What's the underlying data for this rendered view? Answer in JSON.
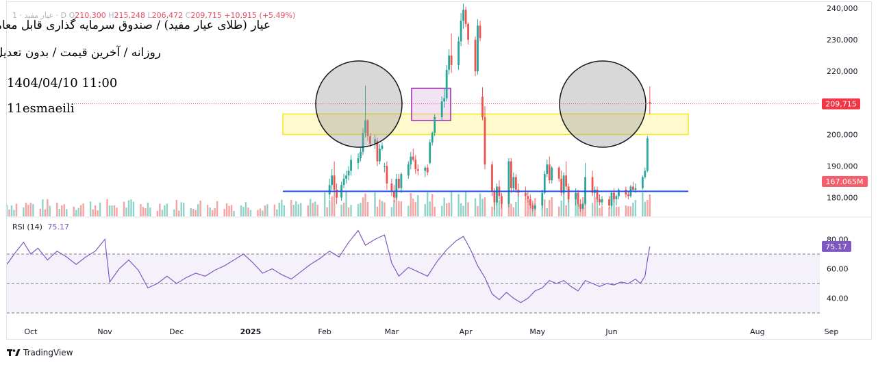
{
  "header": {
    "ohlc_symbol": "عیار مفید · 1 · D",
    "open_label": "O",
    "open_value": "210,300",
    "high_label": "H",
    "high_value": "215,248",
    "low_label": "L",
    "low_value": "206,472",
    "close_label": "C",
    "close_value": "209,715",
    "change_value": "+10,915 (+5.49%)",
    "title": "عیار (طلای عیار مفید) / صندوق سرمایه گذاری قابل معامله",
    "subtitle": "روزانه / آخرین قیمت / بدون تعدیل",
    "datetime": "1404/04/10 11:00",
    "author": "11esmaeili"
  },
  "price_axis": {
    "ticks": [
      "240,000",
      "230,000",
      "220,000",
      "210,000",
      "200,000",
      "190,000",
      "180,000"
    ],
    "last_price_label": "209,715",
    "volume_label": "167.065M"
  },
  "rsi": {
    "legend_label": "RSI (14)",
    "legend_value": "75.17",
    "ticks": [
      "80.00",
      "60.00",
      "40.00"
    ],
    "value_label": "75.17"
  },
  "time_axis": {
    "labels": [
      "Oct",
      "Nov",
      "Dec",
      "2025",
      "Feb",
      "Mar",
      "Apr",
      "May",
      "Jun",
      "Aug",
      "Sep"
    ]
  },
  "branding": {
    "name": "TradingView"
  },
  "colors": {
    "up": "#26a69a",
    "down": "#ef5350",
    "rsi_line": "#7e57c2",
    "rsi_band": "#ede7f6",
    "support_line": "#1e53e5",
    "zone_fill": "#fff9c4",
    "zone_stroke": "#f5e71c",
    "box_stroke": "#9c27b0",
    "last_price": "#f23645"
  },
  "chart_data": {
    "type": "candlestick",
    "xlabel": "",
    "ylabel": "",
    "ylim": [
      175000,
      242000
    ],
    "rsi_ylim": [
      30,
      85
    ],
    "rsi_levels": [
      70,
      50,
      30
    ],
    "support_level": 182000,
    "zone_range": [
      200000,
      206500
    ],
    "last_price": 209715,
    "candles": [
      {
        "date": "2025-02-03",
        "o": 181000,
        "h": 186000,
        "l": 179500,
        "c": 184000
      },
      {
        "date": "2025-02-04",
        "o": 184000,
        "h": 189000,
        "l": 182500,
        "c": 187000
      },
      {
        "date": "2025-02-05",
        "o": 187000,
        "h": 191500,
        "l": 180500,
        "c": 182500
      },
      {
        "date": "2025-02-06",
        "o": 182500,
        "h": 184500,
        "l": 178000,
        "c": 180000
      },
      {
        "date": "2025-02-08",
        "o": 180000,
        "h": 185000,
        "l": 179000,
        "c": 184000
      },
      {
        "date": "2025-02-09",
        "o": 184000,
        "h": 187500,
        "l": 183000,
        "c": 186000
      },
      {
        "date": "2025-02-10",
        "o": 186000,
        "h": 188500,
        "l": 184500,
        "c": 187000
      },
      {
        "date": "2025-02-11",
        "o": 187000,
        "h": 190000,
        "l": 185500,
        "c": 188500
      },
      {
        "date": "2025-02-12",
        "o": 188500,
        "h": 193500,
        "l": 187000,
        "c": 192000
      },
      {
        "date": "2025-02-15",
        "o": 191000,
        "h": 194000,
        "l": 189000,
        "c": 192500
      },
      {
        "date": "2025-02-16",
        "o": 192500,
        "h": 196000,
        "l": 191500,
        "c": 194500
      },
      {
        "date": "2025-02-17",
        "o": 194500,
        "h": 202000,
        "l": 193500,
        "c": 200500
      },
      {
        "date": "2025-02-18",
        "o": 200500,
        "h": 215500,
        "l": 199000,
        "c": 204500
      },
      {
        "date": "2025-02-19",
        "o": 204500,
        "h": 204800,
        "l": 198000,
        "c": 199500
      },
      {
        "date": "2025-02-20",
        "o": 199500,
        "h": 200500,
        "l": 196000,
        "c": 197000
      },
      {
        "date": "2025-02-22",
        "o": 197000,
        "h": 200000,
        "l": 195500,
        "c": 198500
      },
      {
        "date": "2025-02-23",
        "o": 198000,
        "h": 199000,
        "l": 190000,
        "c": 191500
      },
      {
        "date": "2025-02-24",
        "o": 191500,
        "h": 197000,
        "l": 190500,
        "c": 195500
      },
      {
        "date": "2025-02-25",
        "o": 195500,
        "h": 197500,
        "l": 195000,
        "c": 196500
      },
      {
        "date": "2025-02-26",
        "o": 190000,
        "h": 191000,
        "l": 188000,
        "c": 190000
      },
      {
        "date": "2025-02-27",
        "o": 190000,
        "h": 191500,
        "l": 182500,
        "c": 184500
      },
      {
        "date": "2025-03-01",
        "o": 184500,
        "h": 186000,
        "l": 180500,
        "c": 182000
      },
      {
        "date": "2025-03-02",
        "o": 182000,
        "h": 184000,
        "l": 178500,
        "c": 180000
      },
      {
        "date": "2025-03-03",
        "o": 180000,
        "h": 187500,
        "l": 179500,
        "c": 186000
      },
      {
        "date": "2025-03-04",
        "o": 186000,
        "h": 187500,
        "l": 182500,
        "c": 183000
      },
      {
        "date": "2025-03-05",
        "o": 183000,
        "h": 188000,
        "l": 181500,
        "c": 187500
      },
      {
        "date": "2025-03-08",
        "o": 187000,
        "h": 191500,
        "l": 186000,
        "c": 190500
      },
      {
        "date": "2025-03-09",
        "o": 190500,
        "h": 194500,
        "l": 189000,
        "c": 193000
      },
      {
        "date": "2025-03-10",
        "o": 193000,
        "h": 195500,
        "l": 191500,
        "c": 192000
      },
      {
        "date": "2025-03-11",
        "o": 192000,
        "h": 193500,
        "l": 187500,
        "c": 189000
      },
      {
        "date": "2025-03-12",
        "o": 189000,
        "h": 190500,
        "l": 187000,
        "c": 188500
      },
      {
        "date": "2025-03-15",
        "o": 188500,
        "h": 190000,
        "l": 186500,
        "c": 189500
      },
      {
        "date": "2025-03-16",
        "o": 189500,
        "h": 190500,
        "l": 187000,
        "c": 188000
      },
      {
        "date": "2025-03-17",
        "o": 191000,
        "h": 198500,
        "l": 190500,
        "c": 197500
      },
      {
        "date": "2025-03-18",
        "o": 197500,
        "h": 201000,
        "l": 196500,
        "c": 200500
      },
      {
        "date": "2025-03-19",
        "o": 200500,
        "h": 206500,
        "l": 199500,
        "c": 205500
      },
      {
        "date": "2025-03-22",
        "o": 205500,
        "h": 212000,
        "l": 204500,
        "c": 210500
      },
      {
        "date": "2025-03-23",
        "o": 210500,
        "h": 214500,
        "l": 208500,
        "c": 211500
      },
      {
        "date": "2025-03-24",
        "o": 211500,
        "h": 222000,
        "l": 210500,
        "c": 220500
      },
      {
        "date": "2025-03-25",
        "o": 220500,
        "h": 227000,
        "l": 219000,
        "c": 225000
      },
      {
        "date": "2025-03-26",
        "o": 225000,
        "h": 232000,
        "l": 219500,
        "c": 222000
      },
      {
        "date": "2025-03-29",
        "o": 222000,
        "h": 231000,
        "l": 220500,
        "c": 229500
      },
      {
        "date": "2025-03-30",
        "o": 229500,
        "h": 238500,
        "l": 228000,
        "c": 236000
      },
      {
        "date": "2025-03-31",
        "o": 236000,
        "h": 241500,
        "l": 233500,
        "c": 239500
      },
      {
        "date": "2025-04-01",
        "o": 239500,
        "h": 240500,
        "l": 234000,
        "c": 235000
      },
      {
        "date": "2025-04-02",
        "o": 235000,
        "h": 235500,
        "l": 228500,
        "c": 230000
      },
      {
        "date": "2025-04-05",
        "o": 230000,
        "h": 231000,
        "l": 218500,
        "c": 220000
      },
      {
        "date": "2025-04-06",
        "o": 220000,
        "h": 236500,
        "l": 219000,
        "c": 234500
      },
      {
        "date": "2025-04-07",
        "o": 234500,
        "h": 236000,
        "l": 229500,
        "c": 230500
      },
      {
        "date": "2025-04-08",
        "o": 212000,
        "h": 215000,
        "l": 204500,
        "c": 205500
      },
      {
        "date": "2025-04-09",
        "o": 205500,
        "h": 209000,
        "l": 189000,
        "c": 190500
      },
      {
        "date": "2025-04-12",
        "o": 190500,
        "h": 191500,
        "l": 180500,
        "c": 182000
      },
      {
        "date": "2025-04-13",
        "o": 182000,
        "h": 183000,
        "l": 176000,
        "c": 178500
      },
      {
        "date": "2025-04-14",
        "o": 178500,
        "h": 184500,
        "l": 177500,
        "c": 183500
      },
      {
        "date": "2025-04-15",
        "o": 183500,
        "h": 185500,
        "l": 179500,
        "c": 180500
      },
      {
        "date": "2025-04-16",
        "o": 180500,
        "h": 181500,
        "l": 176500,
        "c": 178000
      },
      {
        "date": "2025-04-19",
        "o": 178000,
        "h": 192500,
        "l": 177000,
        "c": 191500
      },
      {
        "date": "2025-04-20",
        "o": 191500,
        "h": 192500,
        "l": 181500,
        "c": 183000
      },
      {
        "date": "2025-04-21",
        "o": 183000,
        "h": 188000,
        "l": 182000,
        "c": 186500
      },
      {
        "date": "2025-04-22",
        "o": 186500,
        "h": 187500,
        "l": 181500,
        "c": 182500
      },
      {
        "date": "2025-04-23",
        "o": 182500,
        "h": 184500,
        "l": 180500,
        "c": 181500
      },
      {
        "date": "2025-04-26",
        "o": 181500,
        "h": 183500,
        "l": 179500,
        "c": 180500
      },
      {
        "date": "2025-04-27",
        "o": 180500,
        "h": 182000,
        "l": 178500,
        "c": 179500
      },
      {
        "date": "2025-04-28",
        "o": 179500,
        "h": 181000,
        "l": 176500,
        "c": 177500
      },
      {
        "date": "2025-04-29",
        "o": 177500,
        "h": 179000,
        "l": 175500,
        "c": 176500
      },
      {
        "date": "2025-04-30",
        "o": 176500,
        "h": 178000,
        "l": 176000,
        "c": 177500
      },
      {
        "date": "2025-05-03",
        "o": 177500,
        "h": 182500,
        "l": 176500,
        "c": 181500
      },
      {
        "date": "2025-05-04",
        "o": 181500,
        "h": 188500,
        "l": 181000,
        "c": 187500
      },
      {
        "date": "2025-05-05",
        "o": 187500,
        "h": 192000,
        "l": 186500,
        "c": 190500
      },
      {
        "date": "2025-05-06",
        "o": 190500,
        "h": 193000,
        "l": 184500,
        "c": 185500
      },
      {
        "date": "2025-05-07",
        "o": 185500,
        "h": 190000,
        "l": 184500,
        "c": 189500
      },
      {
        "date": "2025-05-10",
        "o": 189500,
        "h": 190000,
        "l": 185000,
        "c": 186000
      },
      {
        "date": "2025-05-11",
        "o": 186000,
        "h": 188500,
        "l": 180500,
        "c": 181500
      },
      {
        "date": "2025-05-12",
        "o": 181500,
        "h": 188000,
        "l": 181000,
        "c": 187000
      },
      {
        "date": "2025-05-13",
        "o": 187000,
        "h": 191500,
        "l": 182500,
        "c": 183500
      },
      {
        "date": "2025-05-14",
        "o": 183500,
        "h": 184500,
        "l": 178500,
        "c": 179500
      },
      {
        "date": "2025-05-17",
        "o": 179500,
        "h": 183000,
        "l": 177500,
        "c": 181500
      },
      {
        "date": "2025-05-18",
        "o": 181500,
        "h": 182500,
        "l": 177000,
        "c": 178000
      },
      {
        "date": "2025-05-19",
        "o": 178000,
        "h": 179500,
        "l": 175500,
        "c": 176500
      },
      {
        "date": "2025-05-20",
        "o": 176500,
        "h": 178500,
        "l": 176000,
        "c": 178000
      },
      {
        "date": "2025-05-21",
        "o": 178000,
        "h": 191000,
        "l": 177500,
        "c": 186500
      },
      {
        "date": "2025-05-24",
        "o": 186500,
        "h": 188500,
        "l": 180500,
        "c": 181500
      },
      {
        "date": "2025-05-25",
        "o": 181500,
        "h": 183500,
        "l": 180000,
        "c": 182500
      },
      {
        "date": "2025-05-26",
        "o": 182500,
        "h": 183500,
        "l": 178500,
        "c": 179500
      },
      {
        "date": "2025-05-27",
        "o": 179500,
        "h": 181000,
        "l": 177500,
        "c": 178500
      },
      {
        "date": "2025-05-28",
        "o": 178500,
        "h": 180500,
        "l": 177500,
        "c": 179500
      },
      {
        "date": "2025-05-31",
        "o": 179500,
        "h": 180500,
        "l": 176500,
        "c": 177500
      },
      {
        "date": "2025-06-01",
        "o": 177500,
        "h": 182000,
        "l": 177000,
        "c": 181500
      },
      {
        "date": "2025-06-02",
        "o": 181500,
        "h": 183000,
        "l": 178500,
        "c": 179500
      },
      {
        "date": "2025-06-03",
        "o": 179500,
        "h": 181000,
        "l": 177500,
        "c": 180500
      },
      {
        "date": "2025-06-04",
        "o": 180500,
        "h": 183000,
        "l": 179500,
        "c": 182500
      },
      {
        "date": "2025-06-07",
        "o": 182500,
        "h": 183500,
        "l": 180000,
        "c": 181000
      },
      {
        "date": "2025-06-08",
        "o": 181000,
        "h": 182000,
        "l": 179500,
        "c": 180500
      },
      {
        "date": "2025-06-09",
        "o": 180500,
        "h": 184000,
        "l": 180000,
        "c": 183500
      },
      {
        "date": "2025-06-10",
        "o": 183500,
        "h": 185000,
        "l": 182000,
        "c": 182500
      },
      {
        "date": "2025-06-11",
        "o": 182500,
        "h": 184500,
        "l": 181500,
        "c": 183000
      },
      {
        "date": "2025-06-14",
        "o": 183000,
        "h": 187000,
        "l": 182500,
        "c": 186500
      },
      {
        "date": "2025-06-15",
        "o": 186500,
        "h": 189500,
        "l": 186000,
        "c": 188500
      },
      {
        "date": "2025-06-16",
        "o": 188500,
        "h": 199500,
        "l": 188000,
        "c": 198800
      },
      {
        "date": "2025-06-17",
        "o": 210300,
        "h": 215248,
        "l": 206472,
        "c": 209715
      }
    ],
    "rsi": [
      {
        "date": "2024-09-21",
        "v": 63
      },
      {
        "date": "2024-09-25",
        "v": 72
      },
      {
        "date": "2024-09-28",
        "v": 78
      },
      {
        "date": "2024-10-01",
        "v": 70
      },
      {
        "date": "2024-10-04",
        "v": 74
      },
      {
        "date": "2024-10-08",
        "v": 66
      },
      {
        "date": "2024-10-12",
        "v": 72
      },
      {
        "date": "2024-10-16",
        "v": 68
      },
      {
        "date": "2024-10-20",
        "v": 63
      },
      {
        "date": "2024-10-24",
        "v": 68
      },
      {
        "date": "2024-10-28",
        "v": 72
      },
      {
        "date": "2024-11-01",
        "v": 80
      },
      {
        "date": "2024-11-03",
        "v": 51
      },
      {
        "date": "2024-11-07",
        "v": 60
      },
      {
        "date": "2024-11-11",
        "v": 66
      },
      {
        "date": "2024-11-15",
        "v": 59
      },
      {
        "date": "2024-11-19",
        "v": 47
      },
      {
        "date": "2024-11-23",
        "v": 50
      },
      {
        "date": "2024-11-27",
        "v": 55
      },
      {
        "date": "2024-12-01",
        "v": 50
      },
      {
        "date": "2024-12-05",
        "v": 54
      },
      {
        "date": "2024-12-09",
        "v": 57
      },
      {
        "date": "2024-12-13",
        "v": 55
      },
      {
        "date": "2024-12-17",
        "v": 59
      },
      {
        "date": "2024-12-21",
        "v": 62
      },
      {
        "date": "2024-12-25",
        "v": 66
      },
      {
        "date": "2024-12-29",
        "v": 70
      },
      {
        "date": "2025-01-02",
        "v": 64
      },
      {
        "date": "2025-01-06",
        "v": 57
      },
      {
        "date": "2025-01-10",
        "v": 60
      },
      {
        "date": "2025-01-14",
        "v": 56
      },
      {
        "date": "2025-01-18",
        "v": 53
      },
      {
        "date": "2025-01-22",
        "v": 58
      },
      {
        "date": "2025-01-26",
        "v": 63
      },
      {
        "date": "2025-01-30",
        "v": 67
      },
      {
        "date": "2025-02-03",
        "v": 72
      },
      {
        "date": "2025-02-07",
        "v": 68
      },
      {
        "date": "2025-02-11",
        "v": 78
      },
      {
        "date": "2025-02-15",
        "v": 86
      },
      {
        "date": "2025-02-18",
        "v": 76
      },
      {
        "date": "2025-02-22",
        "v": 80
      },
      {
        "date": "2025-02-26",
        "v": 83
      },
      {
        "date": "2025-03-01",
        "v": 64
      },
      {
        "date": "2025-03-04",
        "v": 55
      },
      {
        "date": "2025-03-08",
        "v": 61
      },
      {
        "date": "2025-03-12",
        "v": 58
      },
      {
        "date": "2025-03-16",
        "v": 55
      },
      {
        "date": "2025-03-20",
        "v": 65
      },
      {
        "date": "2025-03-24",
        "v": 73
      },
      {
        "date": "2025-03-28",
        "v": 79
      },
      {
        "date": "2025-03-31",
        "v": 82
      },
      {
        "date": "2025-04-03",
        "v": 73
      },
      {
        "date": "2025-04-06",
        "v": 62
      },
      {
        "date": "2025-04-09",
        "v": 54
      },
      {
        "date": "2025-04-12",
        "v": 43
      },
      {
        "date": "2025-04-15",
        "v": 39
      },
      {
        "date": "2025-04-18",
        "v": 44
      },
      {
        "date": "2025-04-21",
        "v": 40
      },
      {
        "date": "2025-04-24",
        "v": 37
      },
      {
        "date": "2025-04-27",
        "v": 40
      },
      {
        "date": "2025-04-30",
        "v": 45
      },
      {
        "date": "2025-05-03",
        "v": 47
      },
      {
        "date": "2025-05-06",
        "v": 52
      },
      {
        "date": "2025-05-09",
        "v": 50
      },
      {
        "date": "2025-05-12",
        "v": 52
      },
      {
        "date": "2025-05-15",
        "v": 48
      },
      {
        "date": "2025-05-18",
        "v": 45
      },
      {
        "date": "2025-05-21",
        "v": 52
      },
      {
        "date": "2025-05-24",
        "v": 50
      },
      {
        "date": "2025-05-27",
        "v": 48
      },
      {
        "date": "2025-05-30",
        "v": 50
      },
      {
        "date": "2025-06-02",
        "v": 49
      },
      {
        "date": "2025-06-05",
        "v": 51
      },
      {
        "date": "2025-06-08",
        "v": 50
      },
      {
        "date": "2025-06-11",
        "v": 53
      },
      {
        "date": "2025-06-13",
        "v": 50
      },
      {
        "date": "2025-06-15",
        "v": 55
      },
      {
        "date": "2025-06-16",
        "v": 66
      },
      {
        "date": "2025-06-17",
        "v": 75.17
      }
    ],
    "volume_period": [
      "2024-09-21",
      "2025-06-17"
    ]
  }
}
